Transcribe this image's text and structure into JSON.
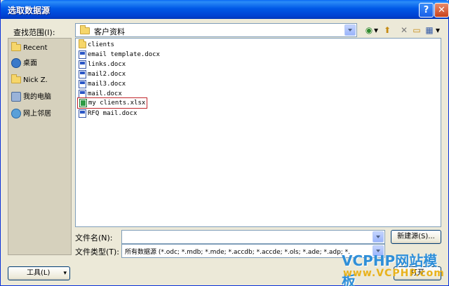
{
  "window": {
    "title": "选取数据源",
    "help_label": "?",
    "close_label": "✕"
  },
  "lookin": {
    "label": "查找范围(I):",
    "value": "客户资料"
  },
  "toolbar": {
    "back_glyph": "◉",
    "back_dropdown_glyph": "▾",
    "up_glyph": "⬆",
    "delete_glyph": "✕",
    "newfolder_glyph": "▭",
    "views_glyph": "▦",
    "views_dropdown_glyph": "▾"
  },
  "places": [
    {
      "label": "Recent",
      "icon": "folder-icon"
    },
    {
      "label": "桌面",
      "icon": "desktop-icon"
    },
    {
      "label": "Nick Z.",
      "icon": "user-folder-icon"
    },
    {
      "label": "我的电脑",
      "icon": "computer-icon"
    },
    {
      "label": "网上邻居",
      "icon": "network-icon"
    }
  ],
  "files": [
    {
      "name": "clients",
      "type": "folder"
    },
    {
      "name": "email template.docx",
      "type": "doc"
    },
    {
      "name": "links.docx",
      "type": "doc"
    },
    {
      "name": "mail2.docx",
      "type": "doc"
    },
    {
      "name": "mail3.docx",
      "type": "doc"
    },
    {
      "name": "mail.docx",
      "type": "doc"
    },
    {
      "name": "my clients.xlsx",
      "type": "xls",
      "highlighted": true
    },
    {
      "name": "RFQ mail.docx",
      "type": "doc"
    }
  ],
  "filename": {
    "label": "文件名(N):",
    "value": ""
  },
  "filetype": {
    "label": "文件类型(T):",
    "value": "所有数据源 (*.odc; *.mdb; *.mde; *.accdb; *.accde; *.ols; *.ade; *.adp; *."
  },
  "buttons": {
    "new_source": "新建源(S)...",
    "tools": "工具(L)",
    "open_partial": "打开"
  },
  "watermark": {
    "line1": "VCPHP网站模板",
    "line2": "www.VCPHP.com"
  },
  "colors": {
    "titlebar": "#0058e6",
    "dialog_bg": "#ece9d8",
    "highlight_border": "#c1272d"
  }
}
